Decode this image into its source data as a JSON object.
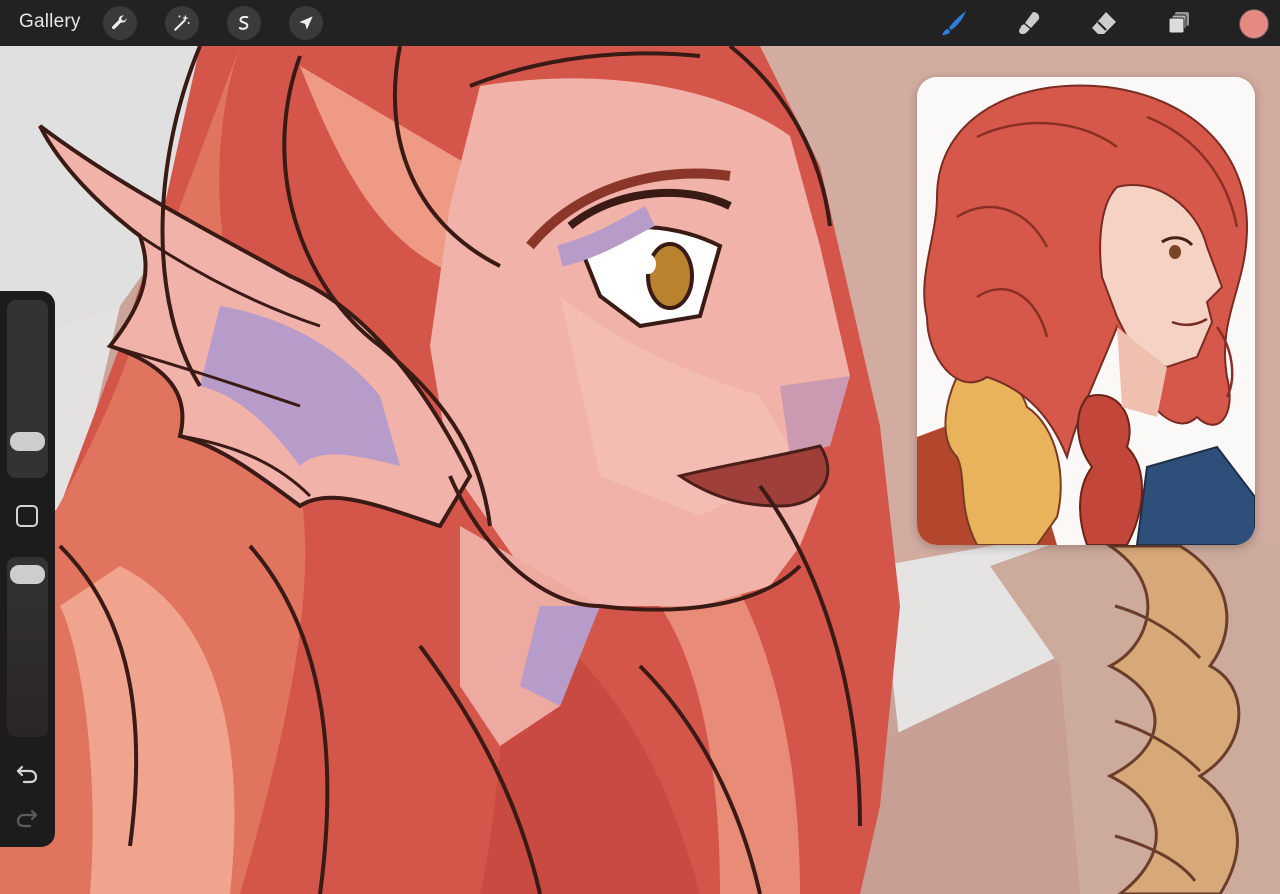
{
  "topbar": {
    "gallery_label": "Gallery",
    "left_tools": [
      {
        "icon": "wrench-icon",
        "name": "actions"
      },
      {
        "icon": "magic-wand-icon",
        "name": "adjustments"
      },
      {
        "icon": "selection-s-icon",
        "name": "selection"
      },
      {
        "icon": "arrow-cursor-icon",
        "name": "transform"
      }
    ],
    "right_tools": [
      {
        "icon": "brush-icon",
        "name": "paint",
        "active": true
      },
      {
        "icon": "smudge-icon",
        "name": "smudge"
      },
      {
        "icon": "eraser-icon",
        "name": "erase"
      },
      {
        "icon": "layers-icon",
        "name": "layers"
      }
    ],
    "current_color": "#e58a82"
  },
  "sidebar": {
    "size_slider_level": 0.16,
    "opacity_slider_level": 0.97,
    "icons": [
      "modify-square-icon",
      "undo-icon",
      "redo-icon"
    ]
  },
  "colors": {
    "accent_active_tool": "#2f7de1",
    "toolbar_bg": "#232222",
    "hair_main": "#d4564a",
    "skin": "#f0b0a8"
  }
}
